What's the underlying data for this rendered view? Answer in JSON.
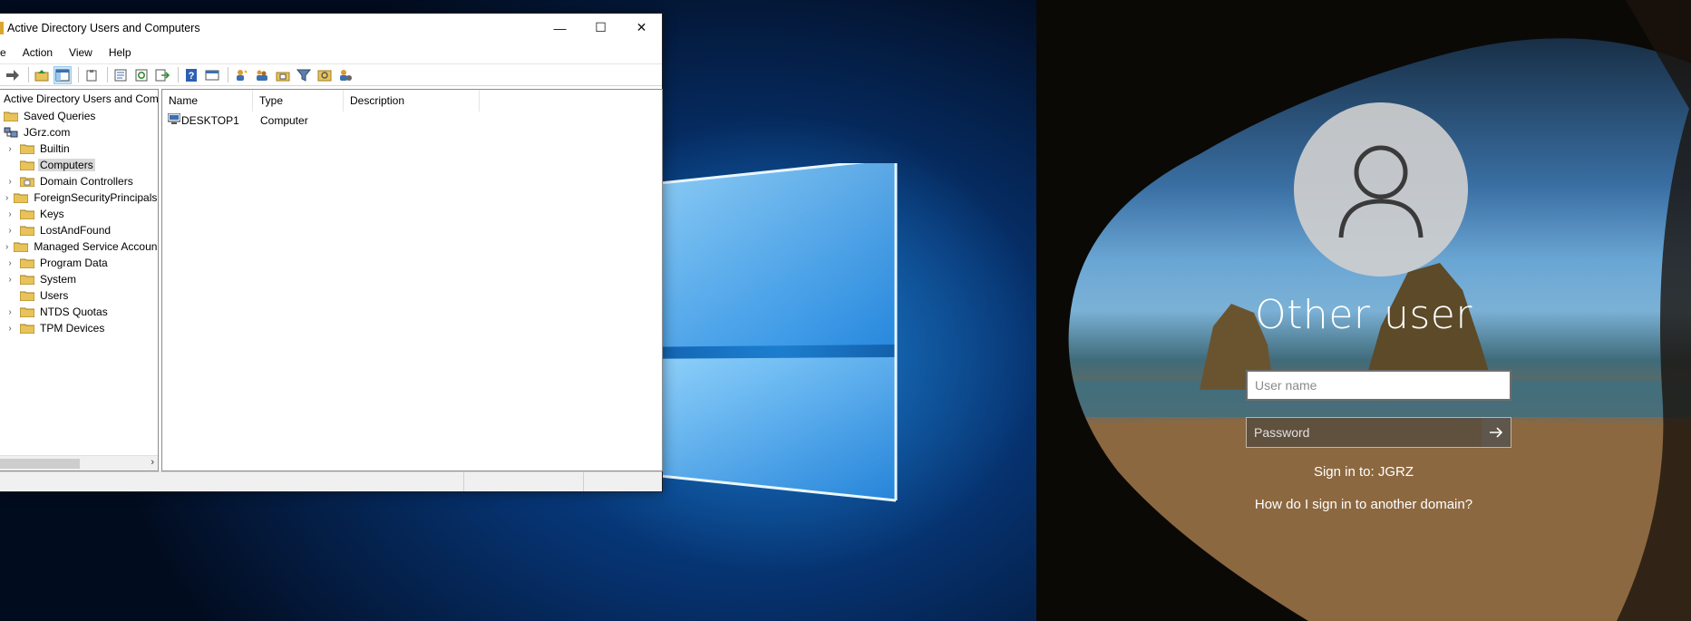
{
  "window": {
    "title": "Active Directory Users and Computers",
    "minimize_glyph": "—",
    "maximize_glyph": "☐",
    "close_glyph": "✕"
  },
  "menu": [
    "e",
    "Action",
    "View",
    "Help"
  ],
  "toolbar": {
    "icons": [
      "forward-arrow-icon",
      "up-folder-icon",
      "show-tree-icon",
      "clipboard-icon",
      "properties-icon",
      "refresh-icon",
      "export-icon",
      "help-icon",
      "console-icon",
      "new-user-icon",
      "new-group-icon",
      "new-ou-icon",
      "filter-icon",
      "find-icon",
      "delegate-icon"
    ]
  },
  "tree": {
    "root_label": "Active Directory Users and Com",
    "items": [
      {
        "label": "Saved Queries",
        "level": 0,
        "expander": "",
        "icon": "folder-icon"
      },
      {
        "label": "JGrz.com",
        "level": 0,
        "expander": "",
        "icon": "domain-icon"
      },
      {
        "label": "Builtin",
        "level": 1,
        "expander": "›",
        "icon": "folder-icon"
      },
      {
        "label": "Computers",
        "level": 1,
        "expander": "",
        "icon": "folder-icon",
        "selected": true
      },
      {
        "label": "Domain Controllers",
        "level": 1,
        "expander": "›",
        "icon": "ou-icon"
      },
      {
        "label": "ForeignSecurityPrincipals",
        "level": 1,
        "expander": "›",
        "icon": "folder-icon"
      },
      {
        "label": "Keys",
        "level": 1,
        "expander": "›",
        "icon": "folder-icon"
      },
      {
        "label": "LostAndFound",
        "level": 1,
        "expander": "›",
        "icon": "folder-icon"
      },
      {
        "label": "Managed Service Accoun",
        "level": 1,
        "expander": "›",
        "icon": "folder-icon"
      },
      {
        "label": "Program Data",
        "level": 1,
        "expander": "›",
        "icon": "folder-icon"
      },
      {
        "label": "System",
        "level": 1,
        "expander": "›",
        "icon": "folder-icon"
      },
      {
        "label": "Users",
        "level": 1,
        "expander": "",
        "icon": "folder-icon"
      },
      {
        "label": "NTDS Quotas",
        "level": 1,
        "expander": "›",
        "icon": "folder-icon"
      },
      {
        "label": "TPM Devices",
        "level": 1,
        "expander": "›",
        "icon": "folder-icon"
      }
    ],
    "scroll_right_glyph": "›"
  },
  "list": {
    "columns": [
      "Name",
      "Type",
      "Description"
    ],
    "rows": [
      {
        "name": "DESKTOP1",
        "type": "Computer",
        "description": "",
        "icon": "computer-icon"
      }
    ]
  },
  "lock_screen": {
    "username": "Other user",
    "username_placeholder": "User name",
    "password_placeholder": "Password",
    "submit_glyph": "→",
    "sign_in_to": "Sign in to: JGRZ",
    "other_domain_link": "How do I sign in to another domain?"
  },
  "colors": {
    "desktop_blue": "#0a4f9e",
    "selection_grey": "#d9d9d9",
    "avatar_grey": "#cecece"
  }
}
